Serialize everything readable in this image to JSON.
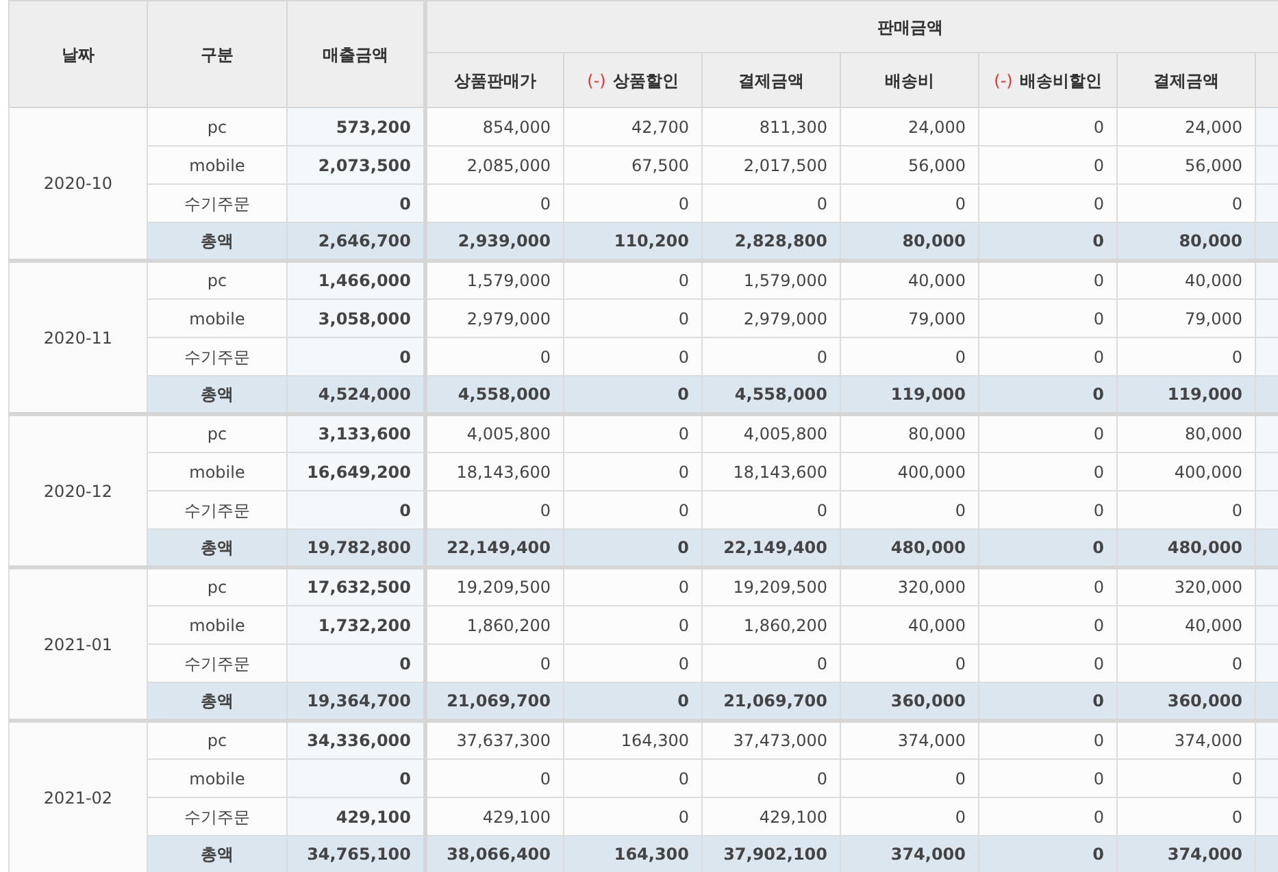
{
  "columns": {
    "date": "날짜",
    "type": "구분",
    "revenue": "매출금액",
    "group": "판매금액",
    "sub": [
      {
        "label": "상품판매가"
      },
      {
        "label": "상품할인",
        "minus_mark": "(-)"
      },
      {
        "label": "결제금액"
      },
      {
        "label": "배송비"
      },
      {
        "label": "배송비할인",
        "minus_mark": "(-)"
      },
      {
        "label": "결제금액"
      }
    ]
  },
  "groups": [
    {
      "date": "2020-10",
      "rows": [
        {
          "kind": "item",
          "label": "pc",
          "values": [
            "573,200",
            "854,000",
            "42,700",
            "811,300",
            "24,000",
            "0",
            "24,000"
          ]
        },
        {
          "kind": "item",
          "label": "mobile",
          "values": [
            "2,073,500",
            "2,085,000",
            "67,500",
            "2,017,500",
            "56,000",
            "0",
            "56,000"
          ]
        },
        {
          "kind": "item",
          "label": "수기주문",
          "values": [
            "0",
            "0",
            "0",
            "0",
            "0",
            "0",
            "0"
          ]
        },
        {
          "kind": "total",
          "label": "총액",
          "values": [
            "2,646,700",
            "2,939,000",
            "110,200",
            "2,828,800",
            "80,000",
            "0",
            "80,000"
          ]
        }
      ]
    },
    {
      "date": "2020-11",
      "rows": [
        {
          "kind": "item",
          "label": "pc",
          "values": [
            "1,466,000",
            "1,579,000",
            "0",
            "1,579,000",
            "40,000",
            "0",
            "40,000"
          ]
        },
        {
          "kind": "item",
          "label": "mobile",
          "values": [
            "3,058,000",
            "2,979,000",
            "0",
            "2,979,000",
            "79,000",
            "0",
            "79,000"
          ]
        },
        {
          "kind": "item",
          "label": "수기주문",
          "values": [
            "0",
            "0",
            "0",
            "0",
            "0",
            "0",
            "0"
          ]
        },
        {
          "kind": "total",
          "label": "총액",
          "values": [
            "4,524,000",
            "4,558,000",
            "0",
            "4,558,000",
            "119,000",
            "0",
            "119,000"
          ]
        }
      ]
    },
    {
      "date": "2020-12",
      "rows": [
        {
          "kind": "item",
          "label": "pc",
          "values": [
            "3,133,600",
            "4,005,800",
            "0",
            "4,005,800",
            "80,000",
            "0",
            "80,000"
          ]
        },
        {
          "kind": "item",
          "label": "mobile",
          "values": [
            "16,649,200",
            "18,143,600",
            "0",
            "18,143,600",
            "400,000",
            "0",
            "400,000"
          ]
        },
        {
          "kind": "item",
          "label": "수기주문",
          "values": [
            "0",
            "0",
            "0",
            "0",
            "0",
            "0",
            "0"
          ]
        },
        {
          "kind": "total",
          "label": "총액",
          "values": [
            "19,782,800",
            "22,149,400",
            "0",
            "22,149,400",
            "480,000",
            "0",
            "480,000"
          ]
        }
      ]
    },
    {
      "date": "2021-01",
      "rows": [
        {
          "kind": "item",
          "label": "pc",
          "values": [
            "17,632,500",
            "19,209,500",
            "0",
            "19,209,500",
            "320,000",
            "0",
            "320,000"
          ]
        },
        {
          "kind": "item",
          "label": "mobile",
          "values": [
            "1,732,200",
            "1,860,200",
            "0",
            "1,860,200",
            "40,000",
            "0",
            "40,000"
          ]
        },
        {
          "kind": "item",
          "label": "수기주문",
          "values": [
            "0",
            "0",
            "0",
            "0",
            "0",
            "0",
            "0"
          ]
        },
        {
          "kind": "total",
          "label": "총액",
          "values": [
            "19,364,700",
            "21,069,700",
            "0",
            "21,069,700",
            "360,000",
            "0",
            "360,000"
          ]
        }
      ]
    },
    {
      "date": "2021-02",
      "rows": [
        {
          "kind": "item",
          "label": "pc",
          "values": [
            "34,336,000",
            "37,637,300",
            "164,300",
            "37,473,000",
            "374,000",
            "0",
            "374,000"
          ]
        },
        {
          "kind": "item",
          "label": "mobile",
          "values": [
            "0",
            "0",
            "0",
            "0",
            "0",
            "0",
            "0"
          ]
        },
        {
          "kind": "item",
          "label": "수기주문",
          "values": [
            "429,100",
            "429,100",
            "0",
            "429,100",
            "0",
            "0",
            "0"
          ]
        },
        {
          "kind": "total",
          "label": "총액",
          "values": [
            "34,765,100",
            "38,066,400",
            "164,300",
            "37,902,100",
            "374,000",
            "0",
            "374,000"
          ]
        }
      ]
    }
  ]
}
